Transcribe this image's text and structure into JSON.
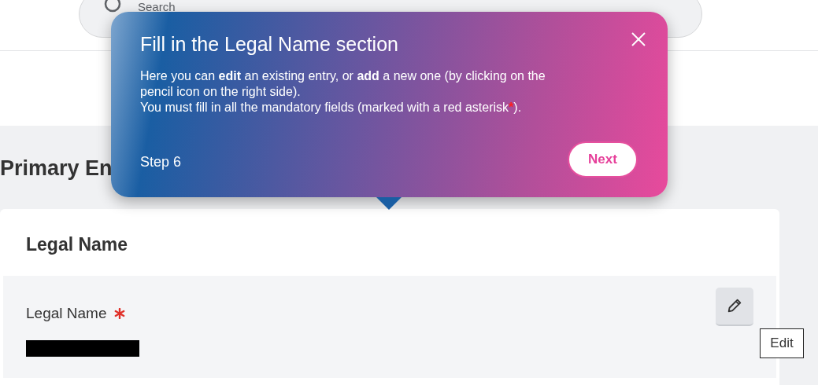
{
  "search": {
    "placeholder": "Search"
  },
  "page_heading": "Primary En",
  "popover": {
    "title": "Fill in the Legal Name section",
    "body": [
      "Here you can **edit** an existing entry, or **add** a new one (by clicking on the pencil icon on the right side).",
      "You must fill in all the mandatory fields (marked with a red asterisk"
    ],
    "asterisk": "*",
    "body_end": ").",
    "step": "Step 6",
    "next_button": "Next"
  },
  "card": {
    "title": "Legal Name",
    "field": {
      "label": "Legal Name",
      "required": true,
      "value_redacted": true
    },
    "tooltip": "Edit"
  }
}
